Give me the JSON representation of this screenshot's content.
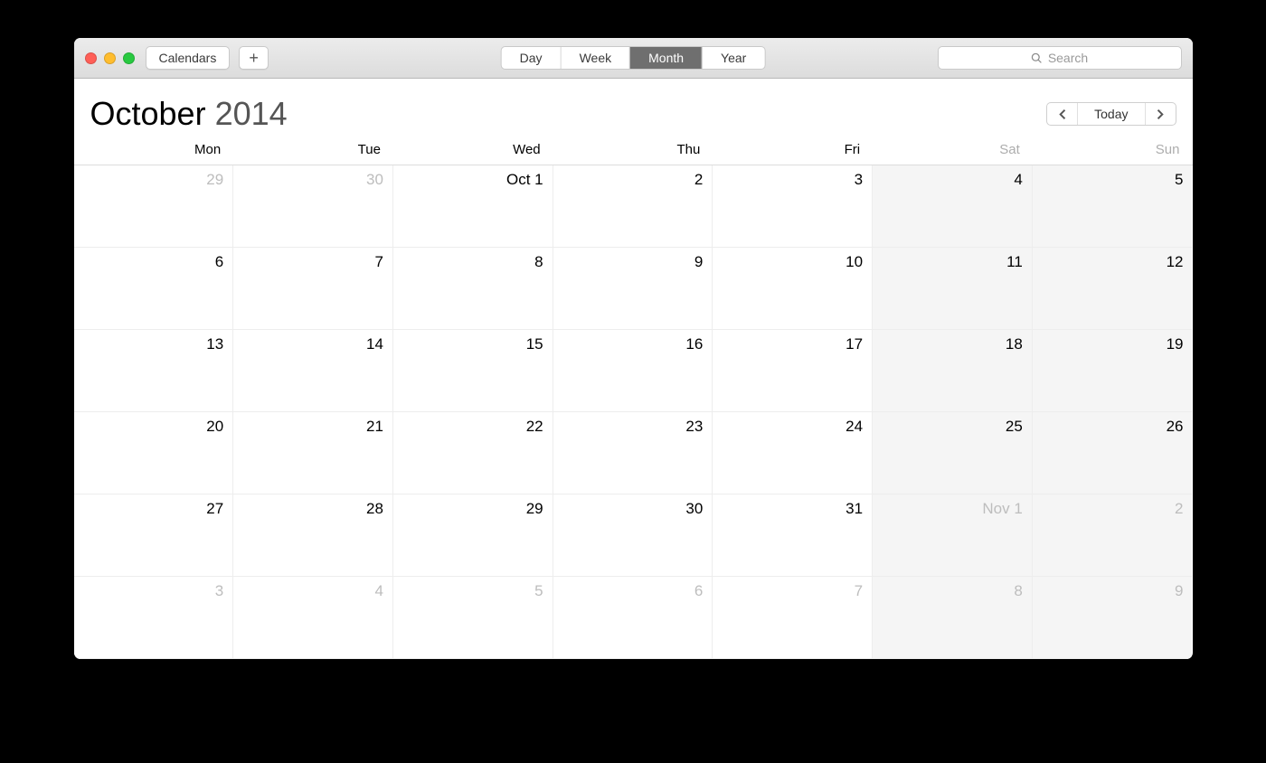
{
  "toolbar": {
    "calendars_label": "Calendars",
    "views": {
      "day": "Day",
      "week": "Week",
      "month": "Month",
      "year": "Year",
      "active": "month"
    },
    "search_placeholder": "Search"
  },
  "header": {
    "month": "October",
    "year": "2014",
    "today_label": "Today"
  },
  "dow": [
    "Mon",
    "Tue",
    "Wed",
    "Thu",
    "Fri",
    "Sat",
    "Sun"
  ],
  "cells": [
    {
      "label": "29",
      "out": true,
      "wknd": false
    },
    {
      "label": "30",
      "out": true,
      "wknd": false
    },
    {
      "label": "Oct 1",
      "out": false,
      "wknd": false
    },
    {
      "label": "2",
      "out": false,
      "wknd": false
    },
    {
      "label": "3",
      "out": false,
      "wknd": false
    },
    {
      "label": "4",
      "out": false,
      "wknd": true
    },
    {
      "label": "5",
      "out": false,
      "wknd": true
    },
    {
      "label": "6",
      "out": false,
      "wknd": false
    },
    {
      "label": "7",
      "out": false,
      "wknd": false
    },
    {
      "label": "8",
      "out": false,
      "wknd": false
    },
    {
      "label": "9",
      "out": false,
      "wknd": false
    },
    {
      "label": "10",
      "out": false,
      "wknd": false
    },
    {
      "label": "11",
      "out": false,
      "wknd": true
    },
    {
      "label": "12",
      "out": false,
      "wknd": true
    },
    {
      "label": "13",
      "out": false,
      "wknd": false
    },
    {
      "label": "14",
      "out": false,
      "wknd": false
    },
    {
      "label": "15",
      "out": false,
      "wknd": false
    },
    {
      "label": "16",
      "out": false,
      "wknd": false
    },
    {
      "label": "17",
      "out": false,
      "wknd": false
    },
    {
      "label": "18",
      "out": false,
      "wknd": true
    },
    {
      "label": "19",
      "out": false,
      "wknd": true
    },
    {
      "label": "20",
      "out": false,
      "wknd": false
    },
    {
      "label": "21",
      "out": false,
      "wknd": false
    },
    {
      "label": "22",
      "out": false,
      "wknd": false
    },
    {
      "label": "23",
      "out": false,
      "wknd": false
    },
    {
      "label": "24",
      "out": false,
      "wknd": false
    },
    {
      "label": "25",
      "out": false,
      "wknd": true
    },
    {
      "label": "26",
      "out": false,
      "wknd": true
    },
    {
      "label": "27",
      "out": false,
      "wknd": false
    },
    {
      "label": "28",
      "out": false,
      "wknd": false
    },
    {
      "label": "29",
      "out": false,
      "wknd": false
    },
    {
      "label": "30",
      "out": false,
      "wknd": false
    },
    {
      "label": "31",
      "out": false,
      "wknd": false
    },
    {
      "label": "Nov 1",
      "out": true,
      "wknd": true
    },
    {
      "label": "2",
      "out": true,
      "wknd": true
    },
    {
      "label": "3",
      "out": true,
      "wknd": false
    },
    {
      "label": "4",
      "out": true,
      "wknd": false
    },
    {
      "label": "5",
      "out": true,
      "wknd": false
    },
    {
      "label": "6",
      "out": true,
      "wknd": false
    },
    {
      "label": "7",
      "out": true,
      "wknd": false
    },
    {
      "label": "8",
      "out": true,
      "wknd": true
    },
    {
      "label": "9",
      "out": true,
      "wknd": true
    }
  ]
}
